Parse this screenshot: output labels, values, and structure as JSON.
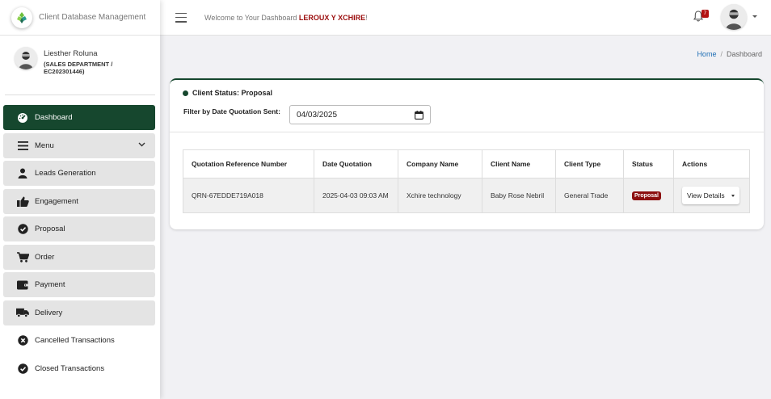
{
  "app": {
    "title": "Client Database Management"
  },
  "user": {
    "name": "Liesther Roluna",
    "department": "(SALES DEPARTMENT / EC202301446)"
  },
  "sidebar": {
    "items": [
      {
        "label": "Dashboard",
        "icon": "gauge-icon",
        "active": true
      },
      {
        "label": "Menu",
        "icon": "menu-icon",
        "expandable": true
      },
      {
        "label": "Leads Generation",
        "icon": "user-icon"
      },
      {
        "label": "Engagement",
        "icon": "thumbs-up-icon"
      },
      {
        "label": "Proposal",
        "icon": "check-circle-icon"
      },
      {
        "label": "Order",
        "icon": "cart-icon"
      },
      {
        "label": "Payment",
        "icon": "wallet-icon"
      },
      {
        "label": "Delivery",
        "icon": "truck-icon"
      },
      {
        "label": "Cancelled Transactions",
        "icon": "x-circle-icon"
      },
      {
        "label": "Closed Transactions",
        "icon": "check-circle-icon"
      }
    ]
  },
  "header": {
    "welcome_prefix": "Welcome to Your Dashboard ",
    "welcome_name": "LEROUX Y XCHIRE",
    "welcome_suffix": "!",
    "notification_count": "7"
  },
  "breadcrumb": {
    "home": "Home",
    "separator": "/",
    "current": "Dashboard"
  },
  "card": {
    "title": "Client Status: Proposal",
    "filter_label": "Filter by Date Quotation Sent:",
    "filter_value": "04/03/2025"
  },
  "table": {
    "columns": [
      "Quotation Reference Number",
      "Date Quotation",
      "Company Name",
      "Client Name",
      "Client Type",
      "Status",
      "Actions"
    ],
    "rows": [
      {
        "ref": "QRN-67EDDE719A018",
        "date": "2025-04-03 09:03 AM",
        "company": "Xchire technology",
        "client": "Baby Rose Nebril",
        "type": "General Trade",
        "status": "Proposal",
        "action": "View Details"
      }
    ]
  },
  "colors": {
    "accent": "#16472e",
    "status": "#8c1010",
    "highlight": "#9b0d0d"
  }
}
